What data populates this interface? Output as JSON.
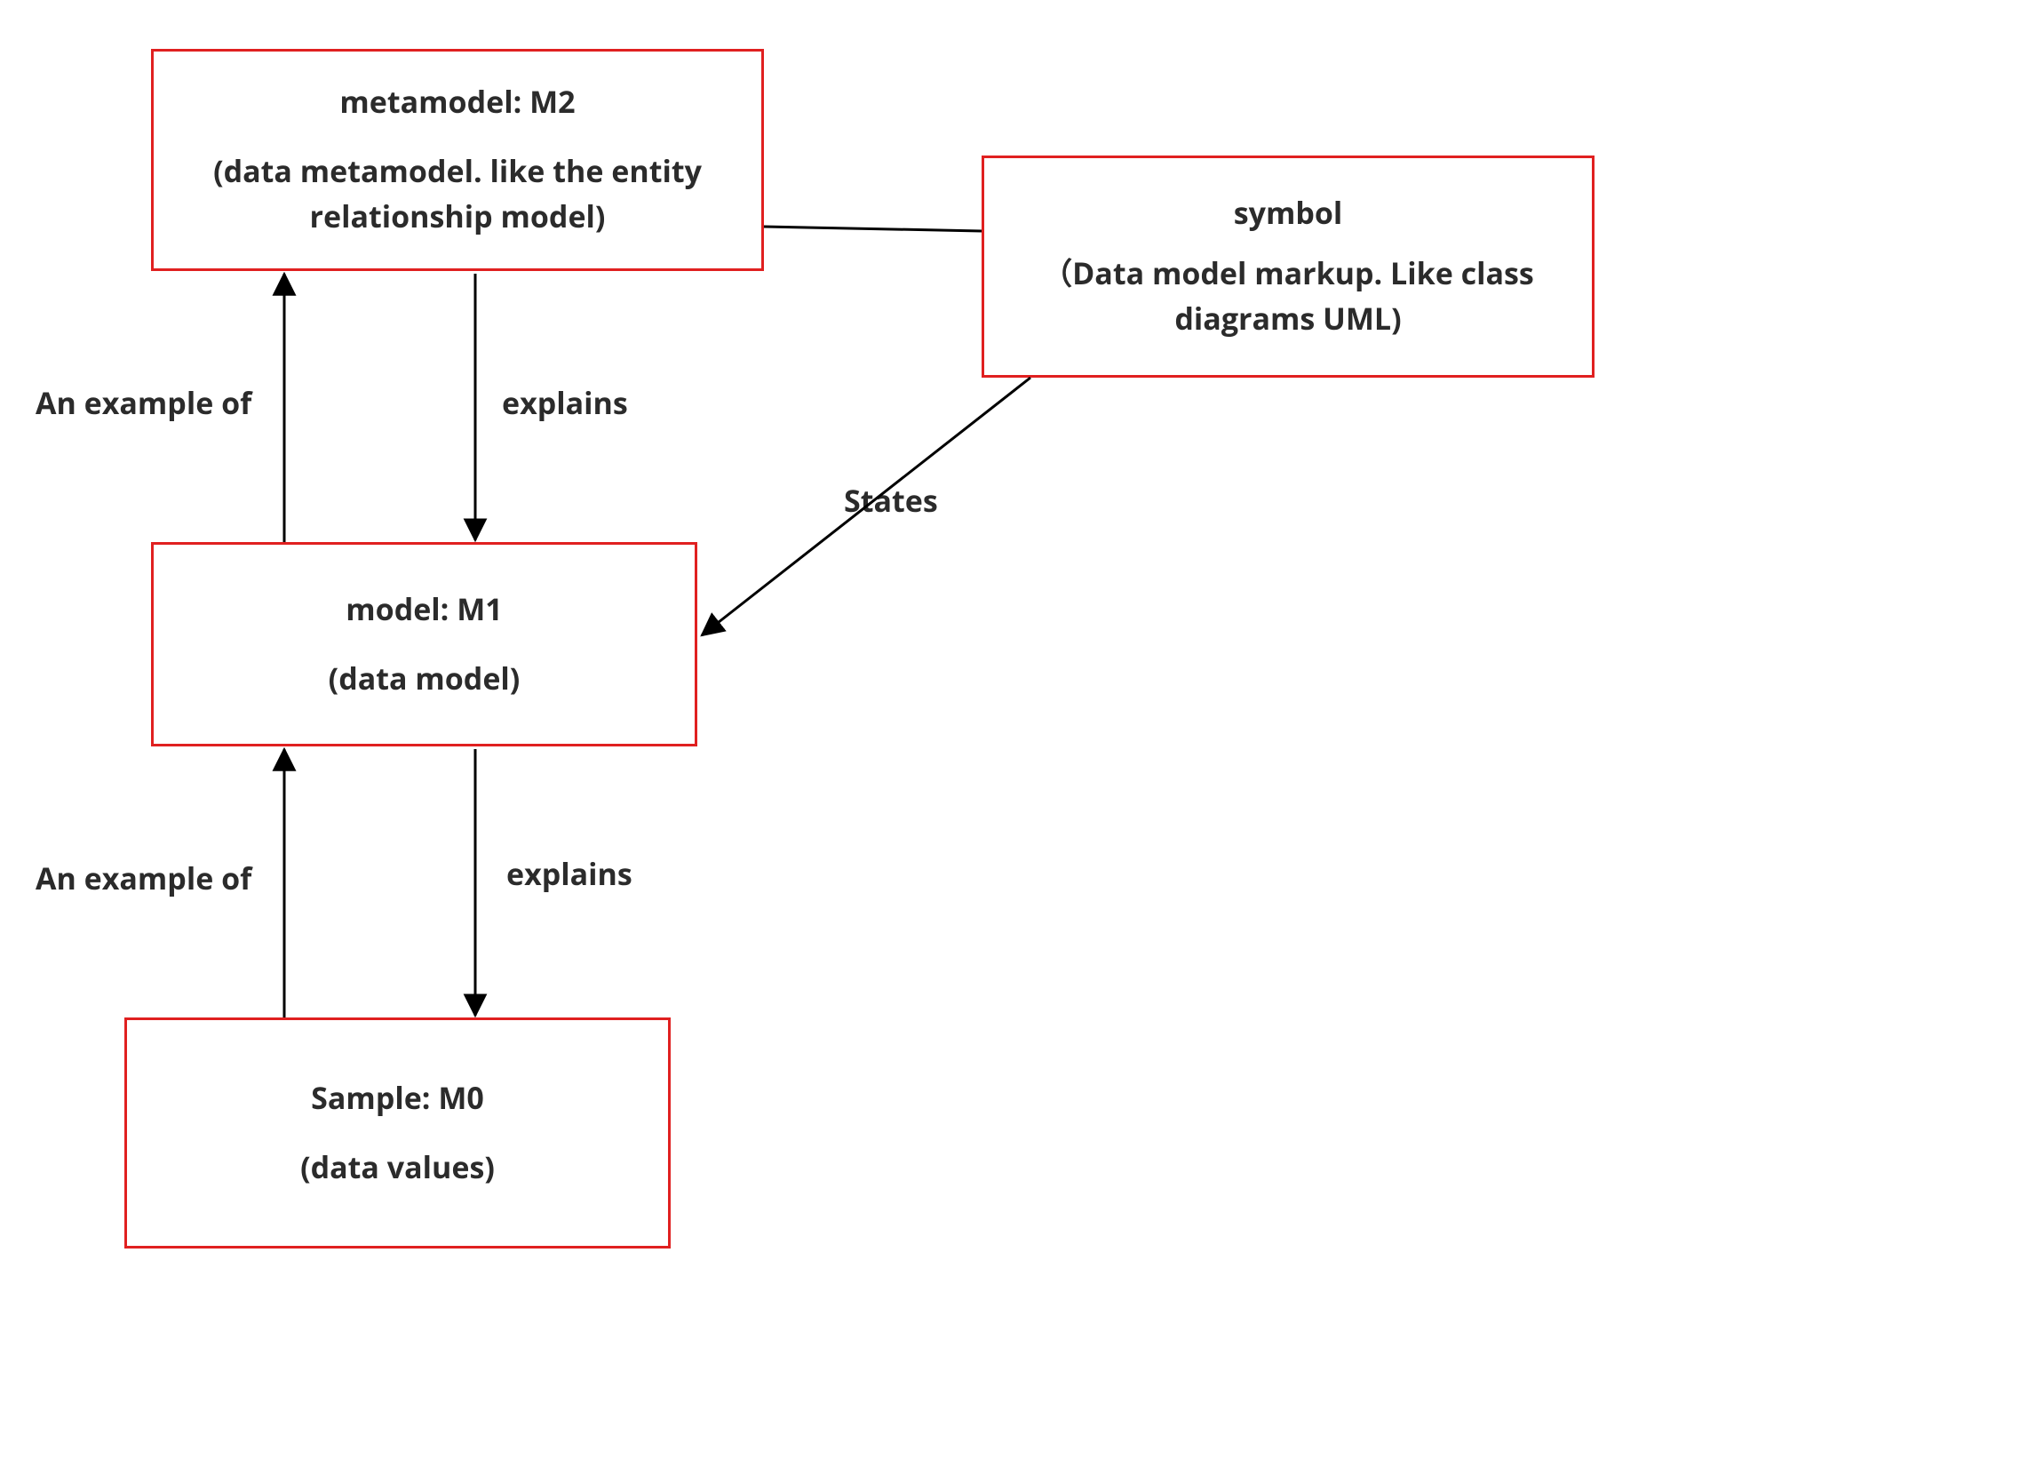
{
  "boxes": {
    "m2": {
      "title": "metamodel: M2",
      "sub": "(data metamodel. like the entity relationship model)"
    },
    "m1": {
      "title": "model: M1",
      "sub": "(data model)"
    },
    "m0": {
      "title": "Sample: M0",
      "sub": "(data values)"
    },
    "symbol": {
      "title": "symbol",
      "sub": "（Data model markup. Like class diagrams  UML)"
    }
  },
  "labels": {
    "example1": "An example of",
    "explains1": "explains",
    "example2": "An example of",
    "explains2": "explains",
    "states": "States"
  }
}
